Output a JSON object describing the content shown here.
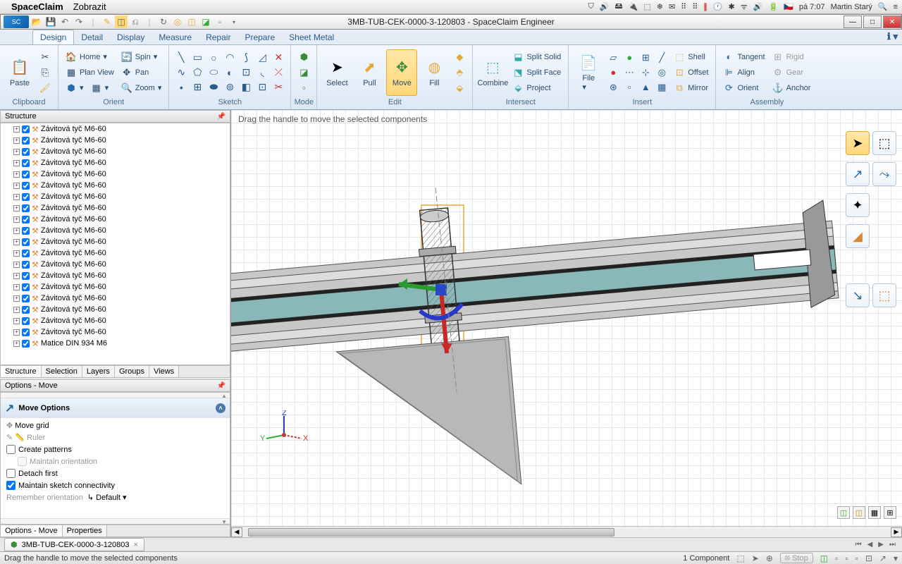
{
  "mac": {
    "app": "SpaceClaim",
    "menu": "Zobrazit",
    "clock": "pá 7:07",
    "user": "Martin Starý"
  },
  "titlebar": {
    "document": "3MB-TUB-CEK-0000-3-120803 - SpaceClaim Engineer"
  },
  "tabs": [
    "Design",
    "Detail",
    "Display",
    "Measure",
    "Repair",
    "Prepare",
    "Sheet Metal"
  ],
  "active_tab": "Design",
  "ribbon": {
    "clipboard": {
      "label": "Clipboard",
      "paste": "Paste"
    },
    "orient": {
      "label": "Orient",
      "home": "Home",
      "plan": "Plan View",
      "spin": "Spin",
      "pan": "Pan",
      "zoom": "Zoom"
    },
    "sketch": {
      "label": "Sketch"
    },
    "mode": {
      "label": "Mode"
    },
    "edit": {
      "label": "Edit",
      "select": "Select",
      "pull": "Pull",
      "move": "Move",
      "fill": "Fill"
    },
    "intersect": {
      "label": "Intersect",
      "combine": "Combine",
      "splitSolid": "Split Solid",
      "splitFace": "Split Face",
      "project": "Project"
    },
    "insert": {
      "label": "Insert",
      "file": "File",
      "shell": "Shell",
      "offset": "Offset",
      "mirror": "Mirror"
    },
    "assembly": {
      "label": "Assembly",
      "tangent": "Tangent",
      "align": "Align",
      "orient": "Orient",
      "rigid": "Rigid",
      "gear": "Gear",
      "anchor": "Anchor"
    }
  },
  "structure": {
    "title": "Structure",
    "items": [
      "Závitová tyč M6-60",
      "Závitová tyč M6-60",
      "Závitová tyč M6-60",
      "Závitová tyč M6-60",
      "Závitová tyč M6-60",
      "Závitová tyč M6-60",
      "Závitová tyč M6-60",
      "Závitová tyč M6-60",
      "Závitová tyč M6-60",
      "Závitová tyč M6-60",
      "Závitová tyč M6-60",
      "Závitová tyč M6-60",
      "Závitová tyč M6-60",
      "Závitová tyč M6-60",
      "Závitová tyč M6-60",
      "Závitová tyč M6-60",
      "Závitová tyč M6-60",
      "Závitová tyč M6-60",
      "Závitová tyč M6-60",
      "Matice DIN 934 M6"
    ],
    "tabs": [
      "Structure",
      "Selection",
      "Layers",
      "Groups",
      "Views"
    ]
  },
  "options": {
    "title": "Options - Move",
    "section": "Move Options",
    "moveGrid": "Move grid",
    "ruler": "Ruler",
    "createPatterns": "Create patterns",
    "maintainOrientation": "Maintain orientation",
    "detachFirst": "Detach first",
    "maintainSketch": "Maintain sketch connectivity",
    "remember": "Remember orientation",
    "default": "Default",
    "tabs": [
      "Options - Move",
      "Properties"
    ]
  },
  "viewport": {
    "hint": "Drag the handle to move the selected components",
    "docTab": "3MB-TUB-CEK-0000-3-120803"
  },
  "status": {
    "hint": "Drag the handle to move the selected components",
    "components": "1 Component",
    "stop": "Stop"
  }
}
